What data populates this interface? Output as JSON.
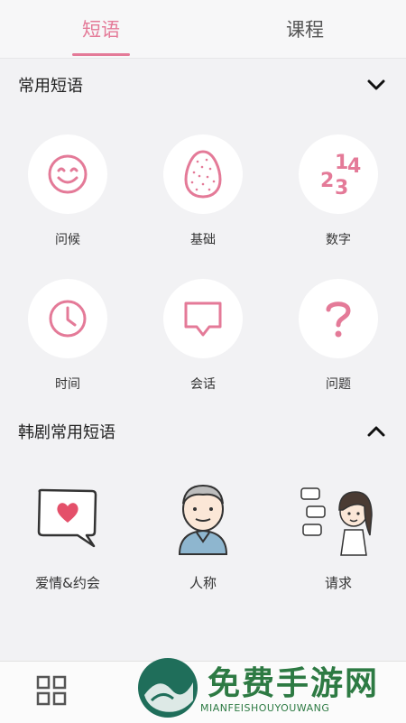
{
  "tabs": [
    {
      "label": "短语",
      "active": true
    },
    {
      "label": "课程",
      "active": false
    }
  ],
  "common": {
    "title": "常用短语",
    "items": [
      {
        "label": "问候",
        "icon": "smile-icon"
      },
      {
        "label": "基础",
        "icon": "egg-icon"
      },
      {
        "label": "数字",
        "icon": "numbers-icon"
      },
      {
        "label": "时间",
        "icon": "clock-icon"
      },
      {
        "label": "会话",
        "icon": "chat-bubble-icon"
      },
      {
        "label": "问题",
        "icon": "question-icon"
      }
    ]
  },
  "korean": {
    "title": "韩剧常用短语",
    "items": [
      {
        "label": "爱情&约会",
        "icon": "heart-bubble-icon"
      },
      {
        "label": "人称",
        "icon": "person-illustration-icon"
      },
      {
        "label": "请求",
        "icon": "girl-illustration-icon"
      }
    ]
  },
  "watermark": {
    "text": "免费手游网",
    "sub": "MIANFEISHOUYOUWANG"
  },
  "colors": {
    "accent": "#e47a98",
    "background": "#f2f2f4"
  }
}
